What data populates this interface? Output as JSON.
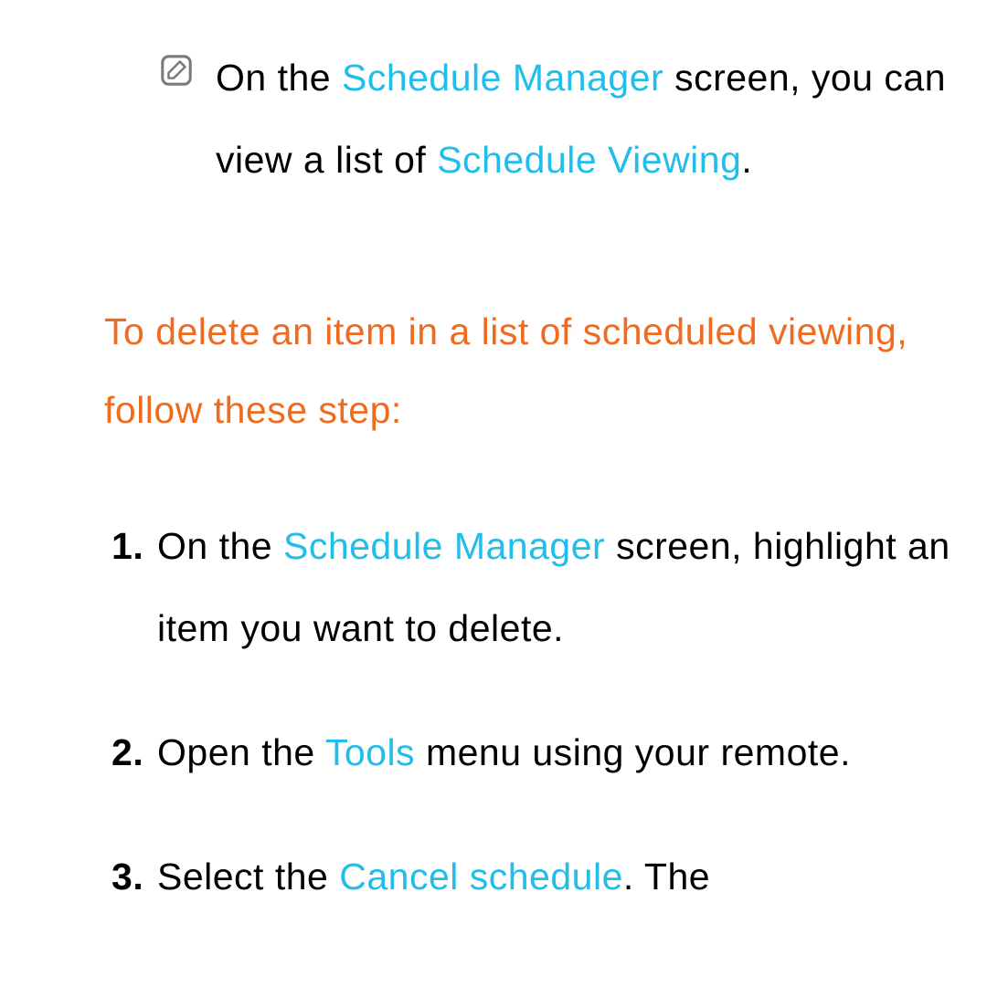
{
  "note": {
    "seg0": "On the ",
    "seg1": "Schedule Manager",
    "seg2": " screen, you can view a list of ",
    "seg3": "Schedule Viewing",
    "seg4": "."
  },
  "heading": "To delete an item in a list of scheduled viewing, follow these step:",
  "steps": [
    {
      "seg0": "On the ",
      "seg1": "Schedule Manager",
      "seg2": " screen, highlight an item you want to delete."
    },
    {
      "seg0": "Open the ",
      "seg1": "Tools",
      "seg2": " menu using your remote."
    },
    {
      "seg0": "Select the ",
      "seg1": "Cancel schedule",
      "seg2": ". The"
    }
  ]
}
